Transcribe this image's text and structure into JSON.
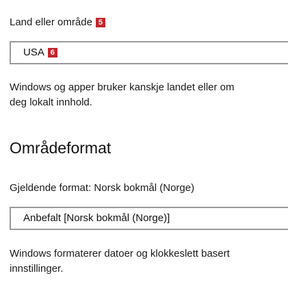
{
  "region": {
    "label": "Land eller område",
    "label_badge": "5",
    "selected_value": "USA",
    "value_badge": "6",
    "description_line1": "Windows og apper bruker kanskje landet eller om",
    "description_line2": "deg lokalt innhold."
  },
  "format": {
    "heading": "Områdeformat",
    "current_format": "Gjeldende format: Norsk bokmål (Norge)",
    "selected_value": "Anbefalt [Norsk bokmål (Norge)]",
    "description_line1": "Windows formaterer datoer og klokkeslett basert",
    "description_line2": "innstillinger."
  },
  "colors": {
    "badge": "#c1272d",
    "dropdown_border": "#999999"
  }
}
